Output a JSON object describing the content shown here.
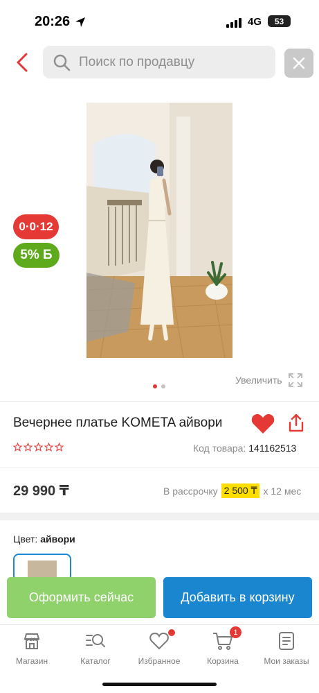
{
  "status_bar": {
    "time": "20:26",
    "network": "4G",
    "battery": "53"
  },
  "search": {
    "placeholder": "Поиск по продавцу"
  },
  "product": {
    "badges": {
      "timer": "0·0·12",
      "bonus": "5%",
      "bonus_currency": "Б"
    },
    "gallery_dots": 2,
    "zoom_label": "Увеличить",
    "title": "Вечернее платье KOMETA айвори",
    "code_label": "Код товара:",
    "code_value": "141162513",
    "rating_stars": 5,
    "price": "29 990 ₸",
    "installment": {
      "prefix": "В рассрочку",
      "amount": "2 500 ₸",
      "suffix": "х 12 мес"
    },
    "color_label": "Цвет:",
    "color_value": "айвори"
  },
  "actions": {
    "checkout": "Оформить сейчас",
    "add_to_cart": "Добавить в корзину"
  },
  "tabbar": {
    "items": [
      {
        "label": "Магазин"
      },
      {
        "label": "Каталог"
      },
      {
        "label": "Избранное"
      },
      {
        "label": "Корзина",
        "badge": "1"
      },
      {
        "label": "Мои заказы"
      }
    ]
  },
  "colors": {
    "accent_red": "#e53935",
    "bonus_green": "#5faa1c",
    "cart_blue": "#1a86d0",
    "checkout_green": "#8fd16a",
    "installment_yellow": "#ffde00"
  }
}
